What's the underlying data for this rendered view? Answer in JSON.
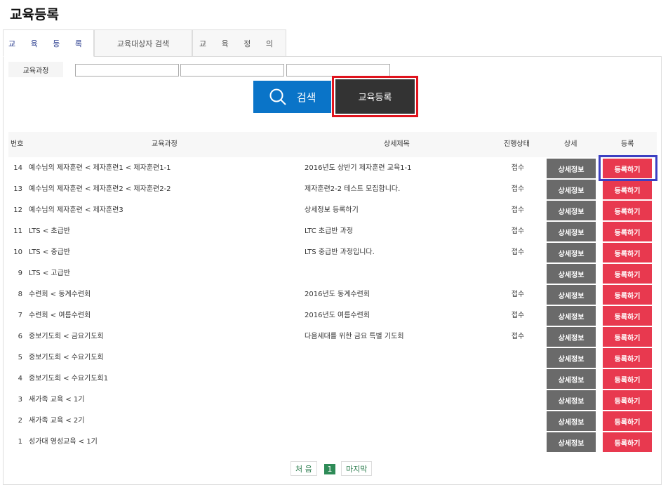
{
  "page_title": "교육등록",
  "tabs": [
    {
      "label": "교 육 등 록"
    },
    {
      "label": "교육대상자 검색"
    },
    {
      "label": "교 육 정 의"
    }
  ],
  "search": {
    "label": "교육과정",
    "inputs": [
      "",
      "",
      ""
    ],
    "search_button": "검색",
    "register_button": "교육등록"
  },
  "table": {
    "headers": [
      "번호",
      "교육과정",
      "상세제목",
      "진행상태",
      "상세",
      "등록"
    ],
    "detail_button": "상세정보",
    "register_button": "등록하기",
    "rows": [
      {
        "no": "14",
        "course": "예수님의 제자훈련 < 제자훈련1 < 제자훈련1-1",
        "detail": "2016년도 상반기 제자훈련 교육1-1",
        "status": "접수"
      },
      {
        "no": "13",
        "course": "예수님의 제자훈련 < 제자훈련2 < 제자훈련2-2",
        "detail": "제자훈련2-2 테스트 모집합니다.",
        "status": "접수"
      },
      {
        "no": "12",
        "course": "예수님의 제자훈련 < 제자훈련3",
        "detail": "상세정보 등록하기",
        "status": "접수"
      },
      {
        "no": "11",
        "course": "LTS < 초급반",
        "detail": "LTC 초급반 과정",
        "status": "접수"
      },
      {
        "no": "10",
        "course": "LTS < 중급반",
        "detail": "LTS 중급반 과정입니다.",
        "status": "접수"
      },
      {
        "no": "9",
        "course": "LTS < 고급반",
        "detail": "",
        "status": ""
      },
      {
        "no": "8",
        "course": "수련회 < 동계수련회",
        "detail": "2016년도 동계수련회",
        "status": "접수"
      },
      {
        "no": "7",
        "course": "수련회 < 여름수련회",
        "detail": "2016년도 여름수련회",
        "status": "접수"
      },
      {
        "no": "6",
        "course": "중보기도회 < 금요기도회",
        "detail": "다음세대를 위한 금요 특별 기도회",
        "status": "접수"
      },
      {
        "no": "5",
        "course": "중보기도회 < 수요기도회",
        "detail": "",
        "status": ""
      },
      {
        "no": "4",
        "course": "중보기도회 < 수요기도회1",
        "detail": "",
        "status": ""
      },
      {
        "no": "3",
        "course": "새가족 교육 < 1기",
        "detail": "",
        "status": ""
      },
      {
        "no": "2",
        "course": "새가족 교육 < 2기",
        "detail": "",
        "status": ""
      },
      {
        "no": "1",
        "course": "성가대 영성교육 < 1기",
        "detail": "",
        "status": ""
      }
    ]
  },
  "pagination": {
    "first": "처 음",
    "current": "1",
    "last": "마지막"
  }
}
